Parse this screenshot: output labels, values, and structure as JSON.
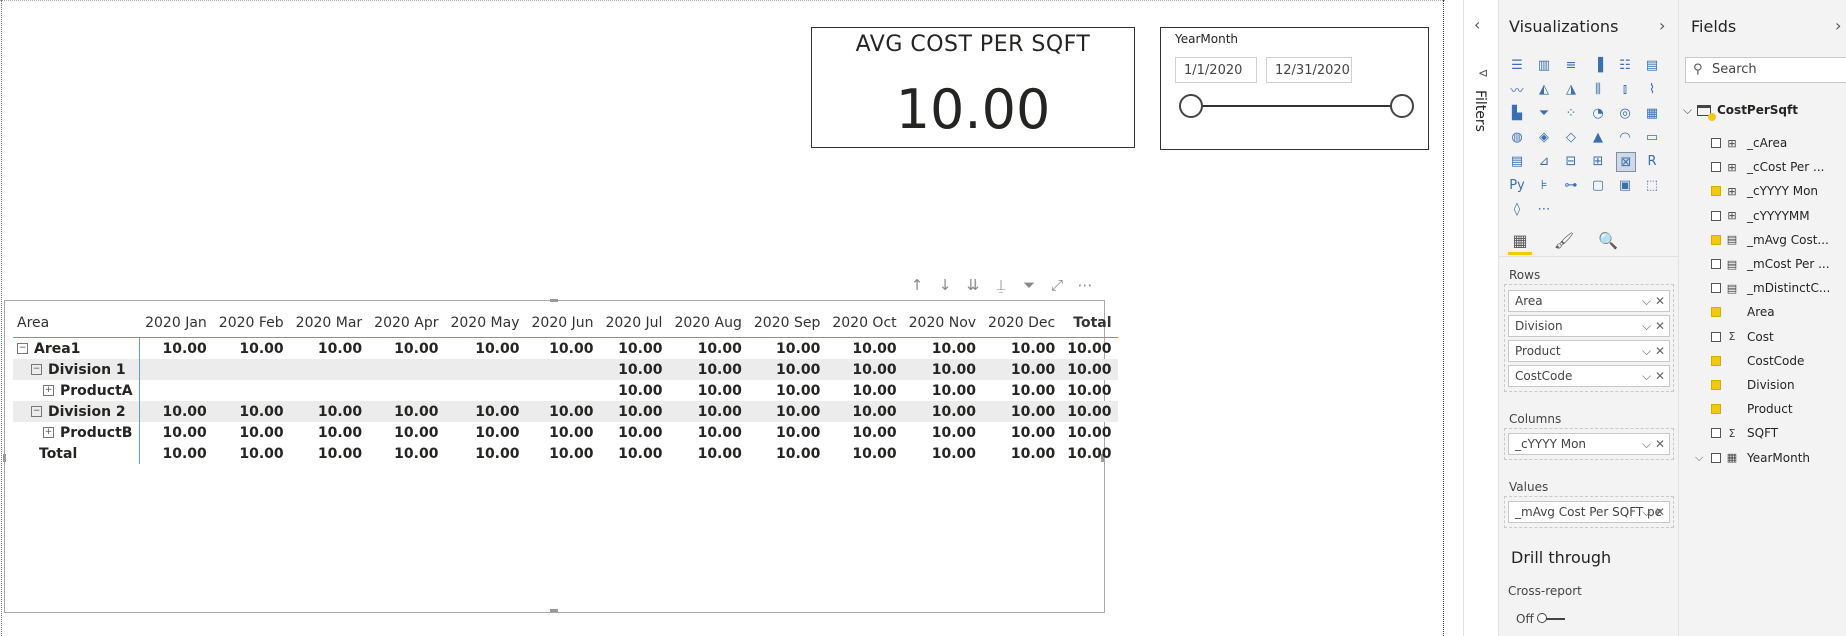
{
  "card": {
    "title": "AVG COST PER SQFT",
    "value": "10.00"
  },
  "slicer": {
    "title": "YearMonth",
    "start": "1/1/2020",
    "end": "12/31/2020"
  },
  "matrix": {
    "row_header": "Area",
    "columns": [
      "2020 Jan",
      "2020 Feb",
      "2020 Mar",
      "2020 Apr",
      "2020 May",
      "2020 Jun",
      "2020 Jul",
      "2020 Aug",
      "2020 Sep",
      "2020 Oct",
      "2020 Nov",
      "2020 Dec"
    ],
    "total_label": "Total",
    "rows": [
      {
        "label": "Area1",
        "level": 0,
        "expander": "minus",
        "shaded": false,
        "values": [
          "10.00",
          "10.00",
          "10.00",
          "10.00",
          "10.00",
          "10.00",
          "10.00",
          "10.00",
          "10.00",
          "10.00",
          "10.00",
          "10.00"
        ],
        "total": "10.00"
      },
      {
        "label": "Division 1",
        "level": 1,
        "expander": "minus",
        "shaded": true,
        "values": [
          "",
          "",
          "",
          "",
          "",
          "",
          "10.00",
          "10.00",
          "10.00",
          "10.00",
          "10.00",
          "10.00"
        ],
        "total": "10.00"
      },
      {
        "label": "ProductA",
        "level": 2,
        "expander": "plus",
        "shaded": false,
        "values": [
          "",
          "",
          "",
          "",
          "",
          "",
          "10.00",
          "10.00",
          "10.00",
          "10.00",
          "10.00",
          "10.00"
        ],
        "total": "10.00"
      },
      {
        "label": "Division 2",
        "level": 1,
        "expander": "minus",
        "shaded": true,
        "values": [
          "10.00",
          "10.00",
          "10.00",
          "10.00",
          "10.00",
          "10.00",
          "10.00",
          "10.00",
          "10.00",
          "10.00",
          "10.00",
          "10.00"
        ],
        "total": "10.00"
      },
      {
        "label": "ProductB",
        "level": 2,
        "expander": "plus",
        "shaded": false,
        "values": [
          "10.00",
          "10.00",
          "10.00",
          "10.00",
          "10.00",
          "10.00",
          "10.00",
          "10.00",
          "10.00",
          "10.00",
          "10.00",
          "10.00"
        ],
        "total": "10.00"
      },
      {
        "label": "Total",
        "level": "total",
        "expander": "",
        "shaded": false,
        "values": [
          "10.00",
          "10.00",
          "10.00",
          "10.00",
          "10.00",
          "10.00",
          "10.00",
          "10.00",
          "10.00",
          "10.00",
          "10.00",
          "10.00"
        ],
        "total": "10.00"
      }
    ],
    "toolbar_icons": [
      "drill-up-icon",
      "drill-down-icon",
      "expand-all-down-icon",
      "expand-hierarchy-icon",
      "filter-icon",
      "focus-mode-icon",
      "more-options-icon"
    ]
  },
  "filters": {
    "label": "Filters",
    "chevron": "‹",
    "funnel": "⊲"
  },
  "viz": {
    "title": "Visualizations",
    "chevron": "›",
    "icons": [
      "stacked-bar-icon",
      "stacked-column-icon",
      "clustered-bar-icon",
      "clustered-column-icon",
      "100pct-bar-icon",
      "100pct-column-icon",
      "line-chart-icon",
      "area-chart-icon",
      "stacked-area-icon",
      "line-column-icon",
      "line-clustered-column-icon",
      "ribbon-chart-icon",
      "waterfall-icon",
      "funnel-icon",
      "scatter-icon",
      "pie-icon",
      "donut-icon",
      "treemap-icon",
      "map-icon",
      "filled-map-icon",
      "shape-map-icon",
      "azure-map-icon",
      "gauge-icon",
      "card-icon",
      "multirow-card-icon",
      "kpi-icon",
      "slicer-icon",
      "table-icon",
      "matrix-icon",
      "r-visual-icon",
      "python-visual-icon",
      "key-influencers-icon",
      "decomposition-tree-icon",
      "qa-icon",
      "smart-narrative-icon",
      "paginated-report-icon",
      "power-apps-icon",
      "more-visuals-icon"
    ],
    "tabs": [
      "fields-tab-icon",
      "format-tab-icon",
      "analytics-tab-icon"
    ],
    "wells": {
      "rows_label": "Rows",
      "rows": [
        "Area",
        "Division",
        "Product",
        "CostCode"
      ],
      "columns_label": "Columns",
      "columns": [
        "_cYYYY Mon"
      ],
      "values_label": "Values",
      "values": [
        "_mAvg Cost Per SQFT pe"
      ]
    },
    "drill_through": "Drill through",
    "cross_report": "Cross-report",
    "toggle_label": "Off"
  },
  "fields": {
    "title": "Fields",
    "chevron": "›",
    "search_placeholder": "Search",
    "table_name": "CostPerSqft",
    "items": [
      {
        "name": "_cArea",
        "checked": false,
        "icon": "calc-column-icon"
      },
      {
        "name": "_cCost Per ...",
        "checked": false,
        "icon": "calc-column-icon"
      },
      {
        "name": "_cYYYY Mon",
        "checked": true,
        "icon": "calc-column-icon"
      },
      {
        "name": "_cYYYYMM",
        "checked": false,
        "icon": "calc-column-icon"
      },
      {
        "name": "_mAvg Cost...",
        "checked": true,
        "icon": "measure-icon"
      },
      {
        "name": "_mCost Per ...",
        "checked": false,
        "icon": "measure-icon"
      },
      {
        "name": "_mDistinctC...",
        "checked": false,
        "icon": "measure-icon"
      },
      {
        "name": "Area",
        "checked": true,
        "icon": ""
      },
      {
        "name": "Cost",
        "checked": false,
        "icon": "sigma-icon"
      },
      {
        "name": "CostCode",
        "checked": true,
        "icon": ""
      },
      {
        "name": "Division",
        "checked": true,
        "icon": ""
      },
      {
        "name": "Product",
        "checked": true,
        "icon": ""
      },
      {
        "name": "SQFT",
        "checked": false,
        "icon": "sigma-icon"
      },
      {
        "name": "YearMonth",
        "checked": false,
        "icon": "date-hierarchy-icon"
      }
    ]
  }
}
